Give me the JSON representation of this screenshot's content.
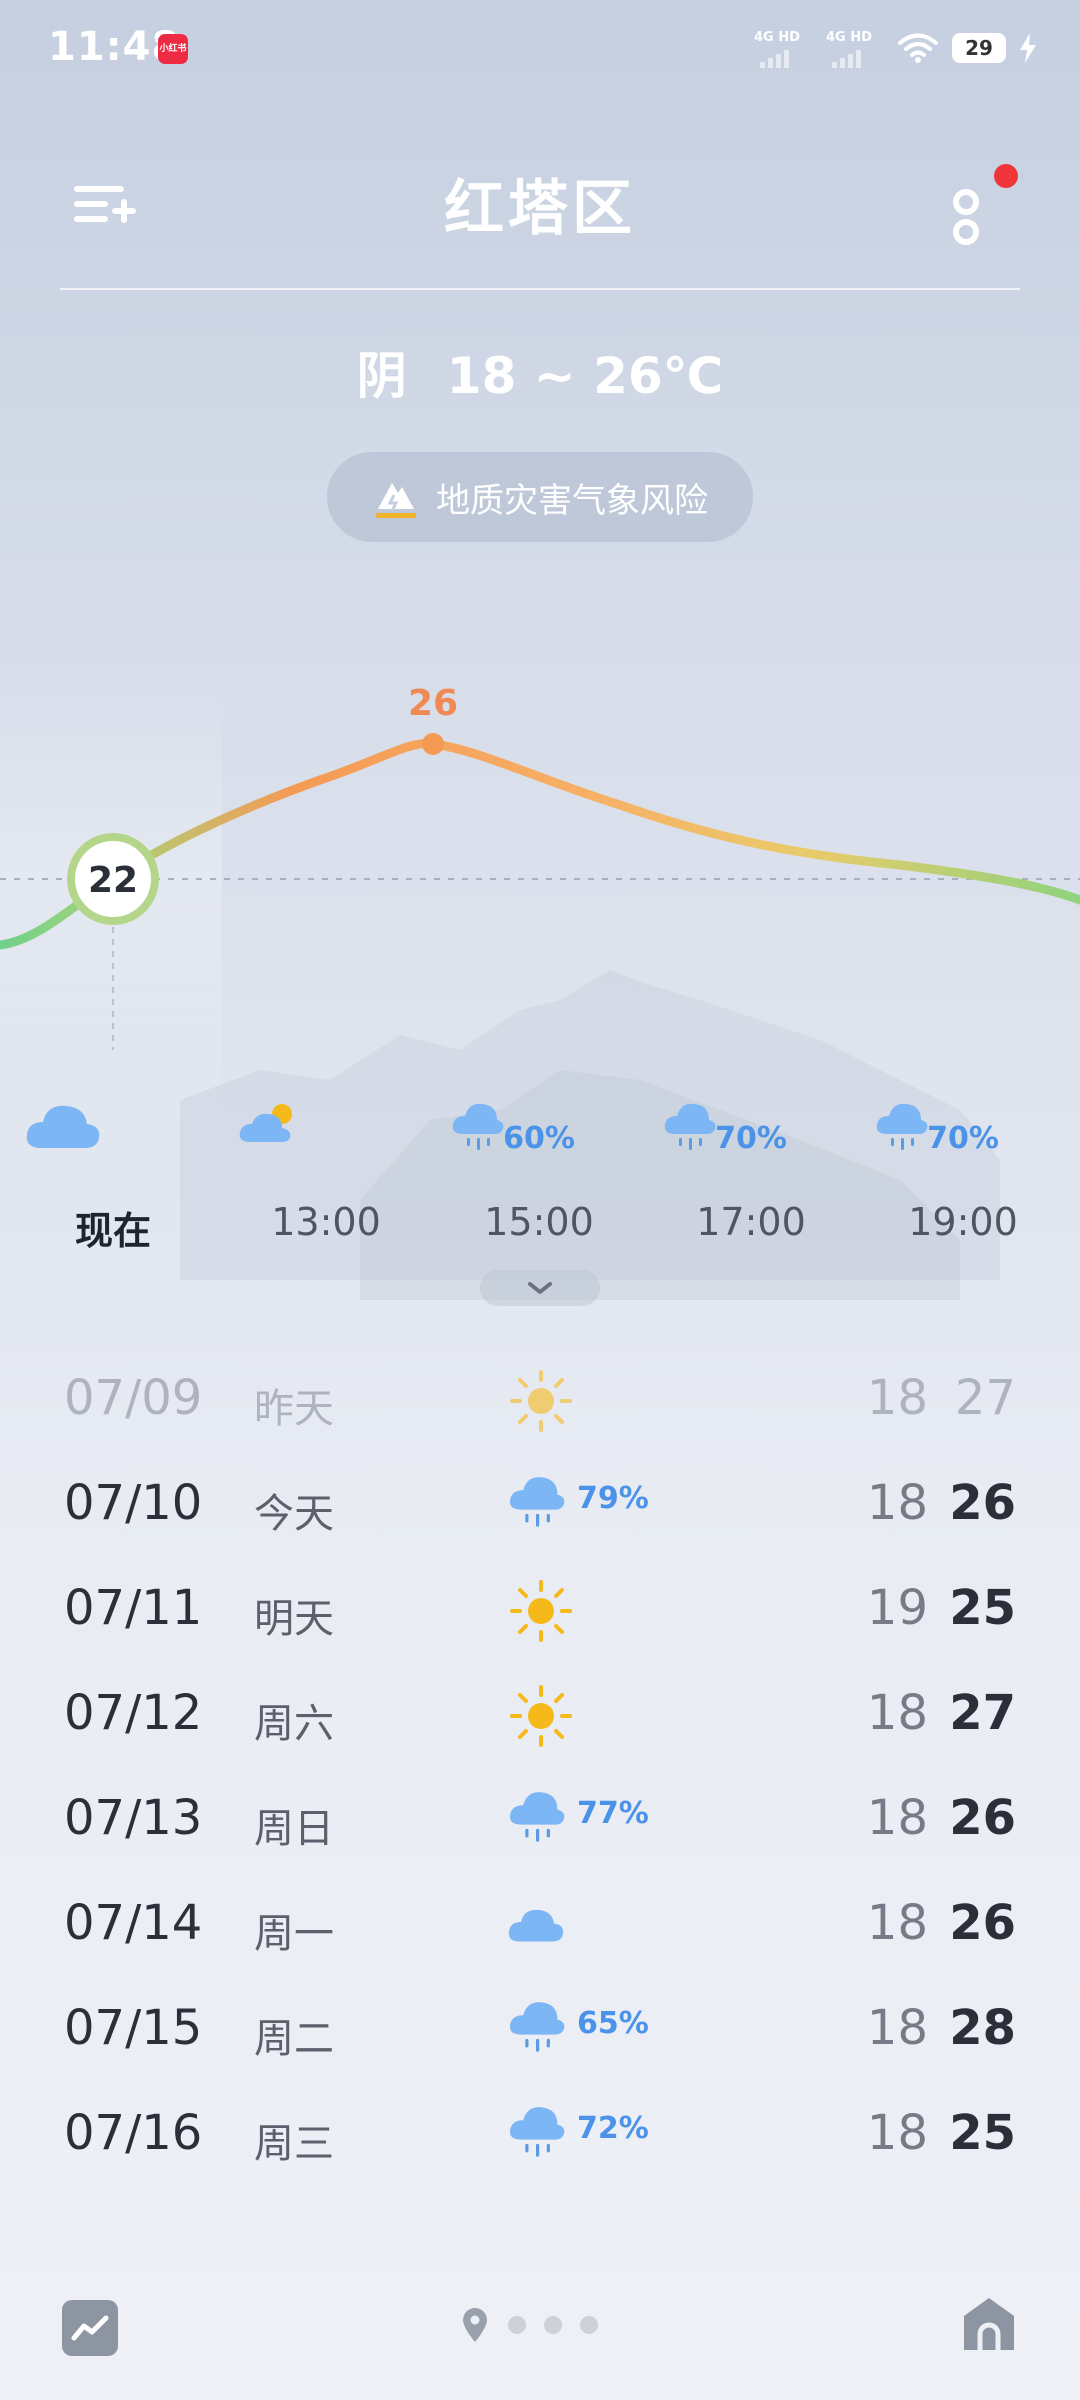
{
  "status_bar": {
    "time": "11:48",
    "app_badge": "小红书",
    "signal_1": "4G HD",
    "signal_2": "4G HD",
    "battery": "29"
  },
  "header": {
    "city": "红塔区"
  },
  "summary": {
    "condition": "阴",
    "temp_range": "18 ~ 26℃"
  },
  "alert": {
    "text": "地质灾害气象风险",
    "color": "#f0b429"
  },
  "hourly": {
    "current_temp": "22",
    "peak_temp": "26",
    "items": [
      {
        "time": "现在",
        "icon": "cloud-icon",
        "pop": ""
      },
      {
        "time": "13:00",
        "icon": "partly-cloudy-icon",
        "pop": ""
      },
      {
        "time": "15:00",
        "icon": "rain-icon",
        "pop": "60%"
      },
      {
        "time": "17:00",
        "icon": "rain-icon",
        "pop": "70%"
      },
      {
        "time": "19:00",
        "icon": "rain-icon",
        "pop": "70%"
      }
    ]
  },
  "daily": [
    {
      "date": "07/09",
      "name": "昨天",
      "icon": "sun-icon",
      "pop": "",
      "low": "18",
      "high": "27",
      "past": true
    },
    {
      "date": "07/10",
      "name": "今天",
      "icon": "rain-icon",
      "pop": "79%",
      "low": "18",
      "high": "26"
    },
    {
      "date": "07/11",
      "name": "明天",
      "icon": "sun-icon",
      "pop": "",
      "low": "19",
      "high": "25"
    },
    {
      "date": "07/12",
      "name": "周六",
      "icon": "sun-icon",
      "pop": "",
      "low": "18",
      "high": "27"
    },
    {
      "date": "07/13",
      "name": "周日",
      "icon": "rain-icon",
      "pop": "77%",
      "low": "18",
      "high": "26"
    },
    {
      "date": "07/14",
      "name": "周一",
      "icon": "cloud-icon",
      "pop": "",
      "low": "18",
      "high": "26"
    },
    {
      "date": "07/15",
      "name": "周二",
      "icon": "rain-icon",
      "pop": "65%",
      "low": "18",
      "high": "28"
    },
    {
      "date": "07/16",
      "name": "周三",
      "icon": "rain-icon",
      "pop": "72%",
      "low": "18",
      "high": "25"
    }
  ],
  "colors": {
    "rain_text": "#4b93e8",
    "sun": "#f6b91a",
    "cloud": "#7db6f5",
    "curve_start": "#6fd08c",
    "curve_peak": "#f59a55"
  }
}
